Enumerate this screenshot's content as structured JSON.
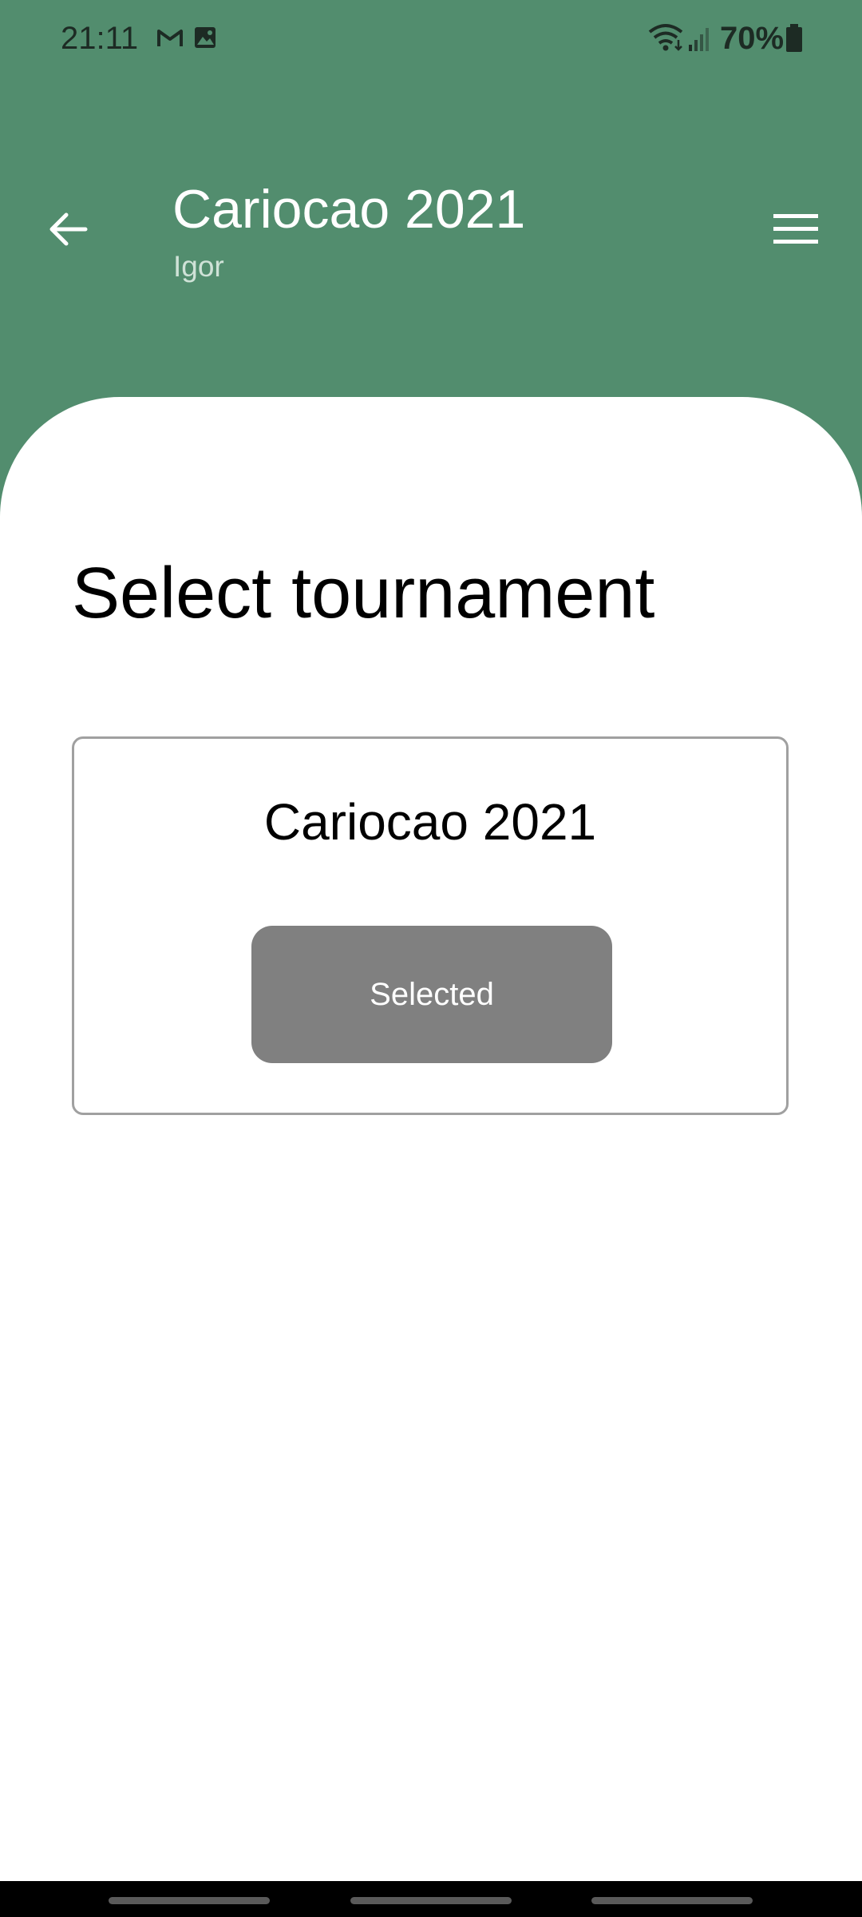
{
  "status_bar": {
    "time": "21:11",
    "battery_percent": "70%",
    "icons": [
      "gmail-icon",
      "gallery-icon",
      "wifi-icon",
      "signal-icon",
      "battery-icon"
    ]
  },
  "app_bar": {
    "title": "Cariocao 2021",
    "subtitle": "Igor",
    "back_icon": "arrow-left-icon",
    "menu_icon": "hamburger-menu-icon"
  },
  "main": {
    "heading": "Select tournament",
    "tournaments": [
      {
        "name": "Cariocao 2021",
        "button_label": "Selected"
      }
    ]
  },
  "colors": {
    "header": "#528d6e",
    "button": "#808080",
    "card_border": "#a0a0a0"
  }
}
